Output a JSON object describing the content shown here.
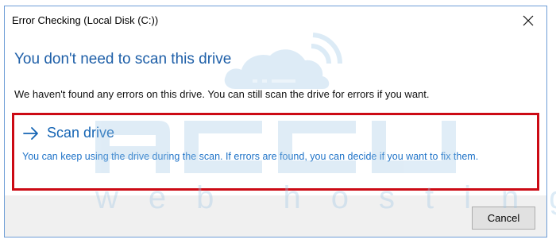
{
  "window": {
    "title": "Error Checking (Local Disk (C:))",
    "close_icon": "close-icon"
  },
  "main": {
    "heading": "You don't need to scan this drive",
    "description": "We haven't found any errors on this drive. You can still scan the drive for errors if you want."
  },
  "scan_option": {
    "arrow_icon": "arrow-right-icon",
    "title": "Scan drive",
    "description": "You can keep using the drive during the scan. If errors are found, you can decide if you want to fix them."
  },
  "footer": {
    "cancel_label": "Cancel"
  },
  "watermark": {
    "brand": "accu",
    "tagline": "web hosting"
  },
  "colors": {
    "heading": "#1e5fa8",
    "link": "#1464b4",
    "highlight_border": "#cc0a14",
    "footer_bg": "#f0f0f0",
    "watermark": "#9ec7e6"
  }
}
